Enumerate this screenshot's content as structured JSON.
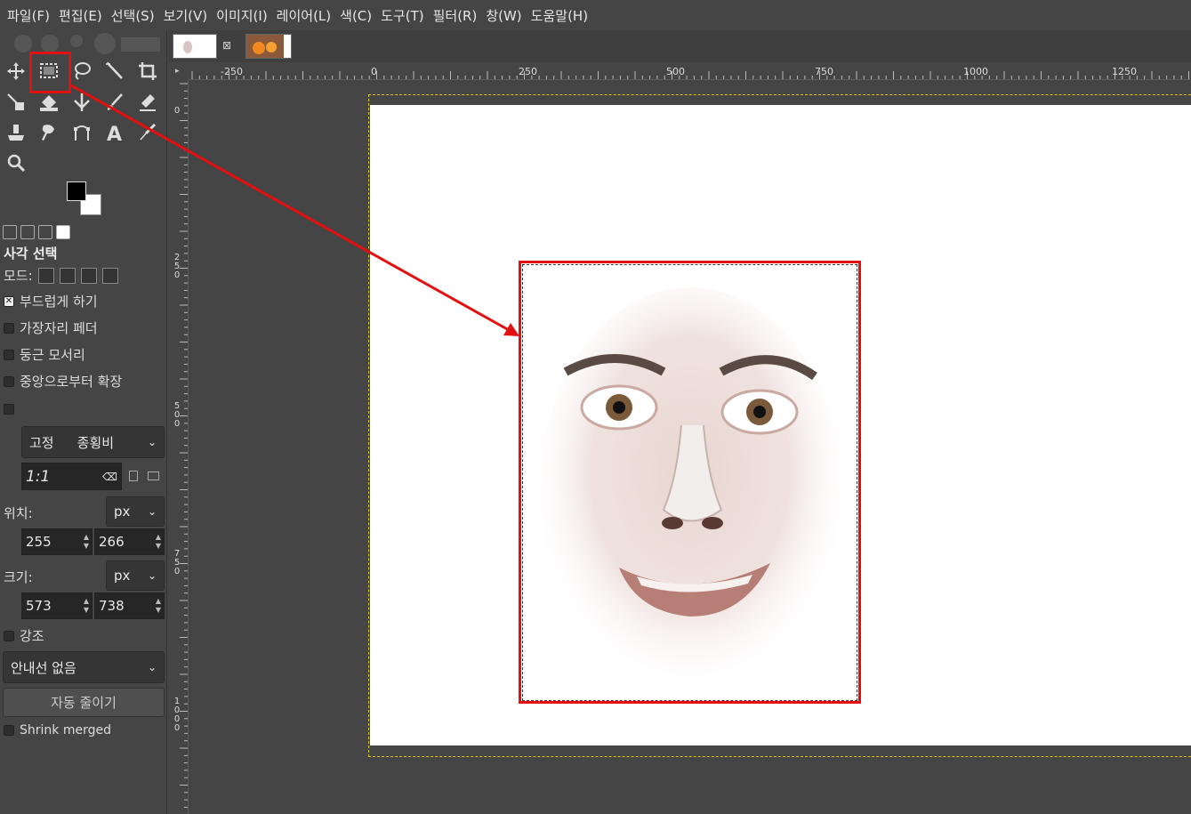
{
  "menu": [
    "파일(F)",
    "편집(E)",
    "선택(S)",
    "보기(V)",
    "이미지(I)",
    "레이어(L)",
    "색(C)",
    "도구(T)",
    "필터(R)",
    "창(W)",
    "도움말(H)"
  ],
  "tools": [
    "move-tool",
    "rect-select-tool",
    "free-select-tool",
    "fuzzy-select-tool",
    "crop-tool",
    "transform-tool",
    "warp-tool",
    "paintbrush-tool",
    "eraser-tool",
    "bucket-fill-tool",
    "clone-tool",
    "smudge-tool",
    "path-tool",
    "text-tool",
    "color-picker-tool",
    "zoom-tool"
  ],
  "tool_options": {
    "title": "사각 선택",
    "mode_label": "모드:",
    "antialias": "부드럽게 하기",
    "feather": "가장자리 페더",
    "rounded": "둥근 모서리",
    "expand_center": "중앙으로부터 확장",
    "fixed_label": "고정",
    "fixed_value": "종횡비",
    "ratio": "1:1",
    "position_label": "위치:",
    "position_unit": "px",
    "pos_x": "255",
    "pos_y": "266",
    "size_label": "크기:",
    "size_unit": "px",
    "size_w": "573",
    "size_h": "738",
    "highlight": "강조",
    "guides": "안내선 없음",
    "auto_shrink": "자동 줄이기",
    "shrink_merged": "Shrink merged"
  },
  "ruler": {
    "top_labels": [
      "-250",
      "0",
      "250",
      "500",
      "750",
      "1000",
      "1250"
    ],
    "left_labels": [
      "0",
      "250",
      "500",
      "750",
      "1000"
    ]
  },
  "colors": {
    "highlight": "#e4100f",
    "fg": "#000000",
    "bg": "#ffffff"
  }
}
